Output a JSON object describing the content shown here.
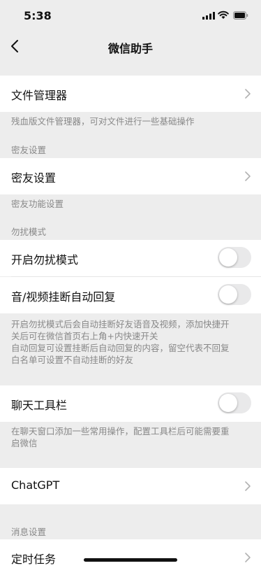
{
  "status_bar": {
    "time": "5:38"
  },
  "nav": {
    "title": "微信助手"
  },
  "sections": {
    "file_manager": {
      "label": "文件管理器",
      "footer": "残血版文件管理器，可对文件进行一些基础操作"
    },
    "close_friend": {
      "header": "密友设置",
      "label": "密友设置",
      "footer": "密友功能设置"
    },
    "dnd": {
      "header": "勿扰模式",
      "enable_label": "开启勿扰模式",
      "enable_on": false,
      "auto_reply_label": "音/视频挂断自动回复",
      "auto_reply_on": false,
      "footer_lines": [
        "开启勿扰模式后会自动挂断好友语音及视频，添加快捷开",
        "关后可在微信首页右上角+内快速开关",
        "自动回复可设置挂断后自动回复的内容，留空代表不回复",
        "白名单可设置不自动挂断的好友"
      ]
    },
    "toolbar": {
      "label": "聊天工具栏",
      "on": false,
      "footer_lines": [
        "在聊天窗口添加一些常用操作，配置工具栏后可能需要重",
        "启微信"
      ]
    },
    "chatgpt": {
      "label": "ChatGPT"
    },
    "message": {
      "header": "消息设置",
      "scheduled_label": "定时任务"
    }
  },
  "colors": {
    "background": "#ededed",
    "cell": "#ffffff",
    "secondary_text": "#888888",
    "toggle_off": "#e9e9ea"
  }
}
